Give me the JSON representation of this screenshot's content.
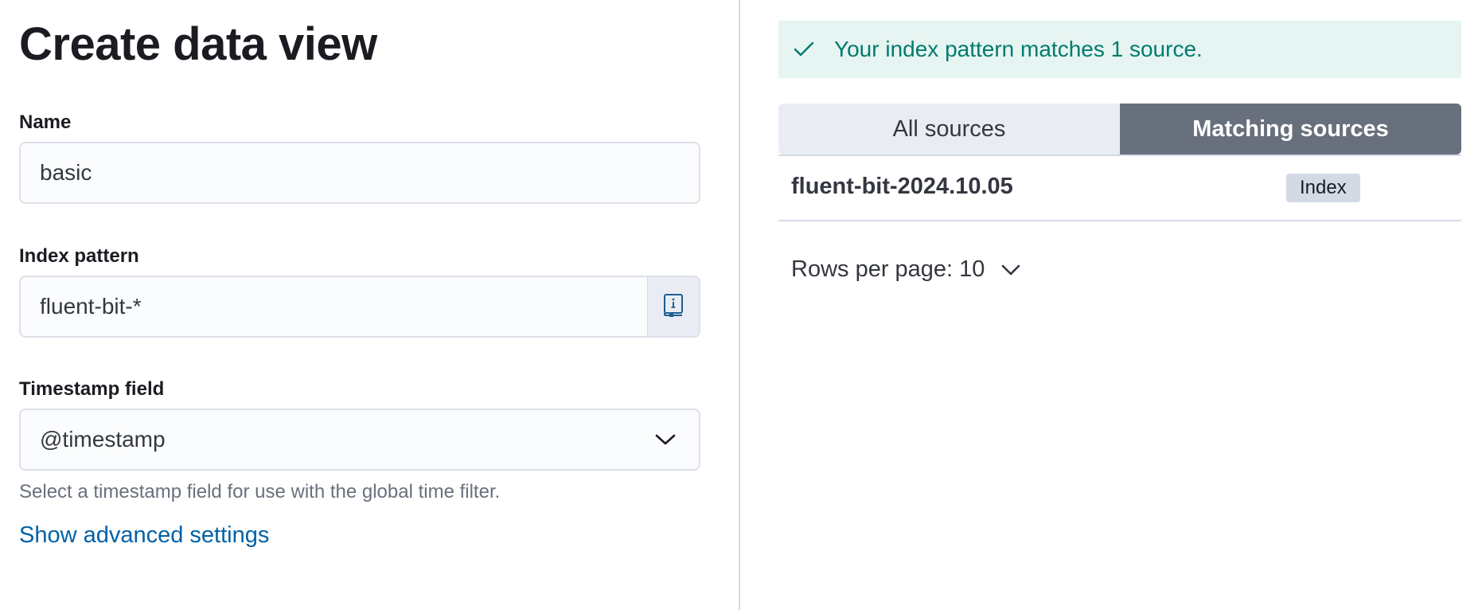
{
  "page": {
    "title": "Create data view"
  },
  "form": {
    "name": {
      "label": "Name",
      "value": "basic"
    },
    "index_pattern": {
      "label": "Index pattern",
      "value": "fluent-bit-*",
      "append_icon": "book-info-icon"
    },
    "timestamp": {
      "label": "Timestamp field",
      "value": "@timestamp",
      "help": "Select a timestamp field for use with the global time filter."
    },
    "advanced_link": "Show advanced settings"
  },
  "preview": {
    "callout": {
      "icon": "check-icon",
      "message": "Your index pattern matches 1 source."
    },
    "tabs": [
      {
        "label": "All sources",
        "selected": false
      },
      {
        "label": "Matching sources",
        "selected": true
      }
    ],
    "rows": [
      {
        "name": "fluent-bit-2024.10.05",
        "type": "Index"
      }
    ],
    "pagination": {
      "rows_per_page_label": "Rows per page: 10"
    }
  },
  "colors": {
    "success_text": "#007b6e",
    "success_bg": "#e6f5f2",
    "link": "#0061a6",
    "selected_tab_bg": "#69707d",
    "tab_bg": "#e9edf3"
  }
}
